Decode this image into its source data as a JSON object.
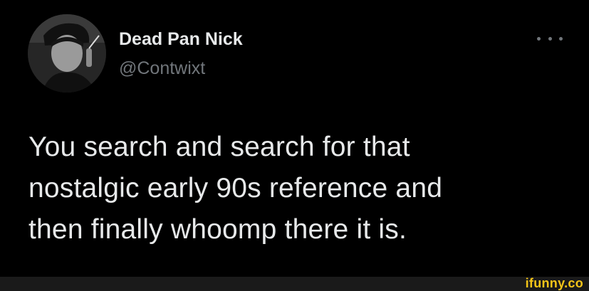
{
  "tweet": {
    "author": {
      "display_name": "Dead Pan Nick",
      "handle": "@Contwixt"
    },
    "more_icon": "more-horizontal-icon",
    "text_lines": [
      "You search and search for that",
      "nostalgic early 90s reference and",
      "then finally whoomp there it is."
    ]
  },
  "watermark": {
    "text": "ifunny.co",
    "color": "#f5c518"
  },
  "colors": {
    "background": "#000000",
    "primary_text": "#e7e9ea",
    "secondary_text": "#71767b"
  }
}
